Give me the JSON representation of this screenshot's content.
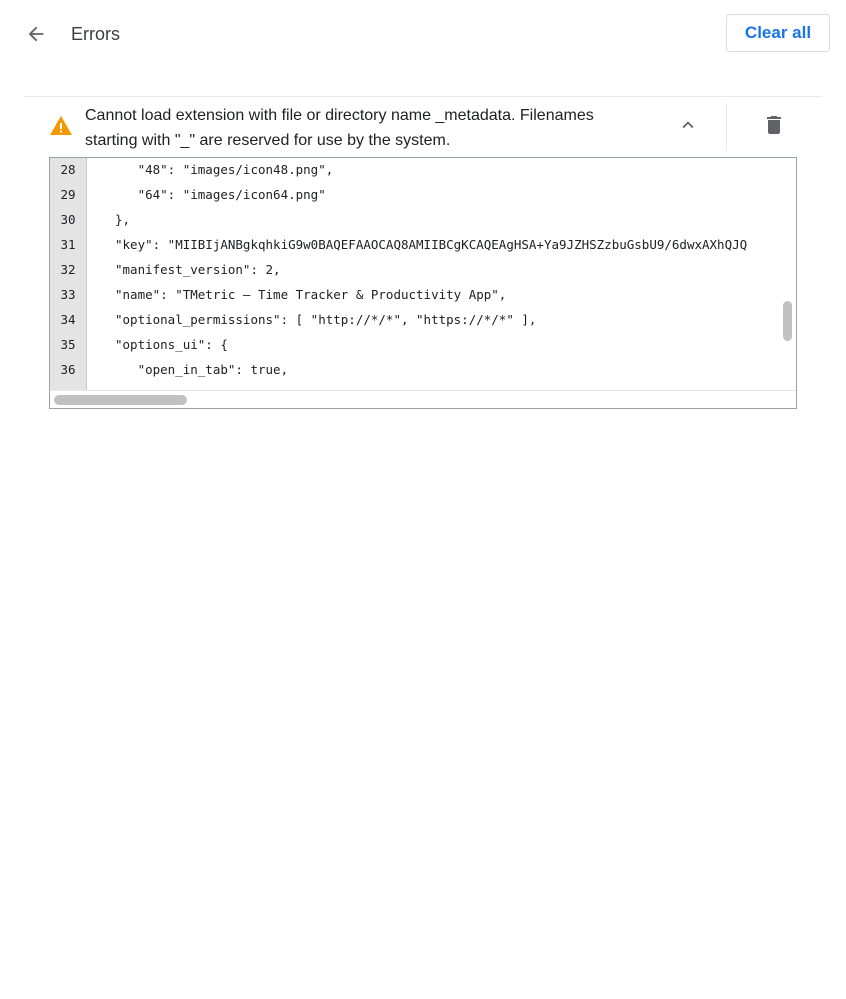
{
  "header": {
    "title": "Errors",
    "back_icon": "arrow-left-icon",
    "clear_all_label": "Clear all"
  },
  "error": {
    "icon": "warning-triangle-icon",
    "message": "Cannot load extension with file or directory name _metadata. Filenames starting with \"_\" are reserved for use by the system.",
    "expand_icon": "chevron-up-icon",
    "delete_icon": "trash-icon"
  },
  "code": {
    "lines": [
      {
        "num": "28",
        "text": "    \"48\": \"images/icon48.png\","
      },
      {
        "num": "29",
        "text": "    \"64\": \"images/icon64.png\""
      },
      {
        "num": "30",
        "text": " },"
      },
      {
        "num": "31",
        "text": " \"key\": \"MIIBIjANBgkqhkiG9w0BAQEFAAOCAQ8AMIIBCgKCAQEAgHSA+Ya9JZHSZzbuGsbU9/6dwxAXhQJQ"
      },
      {
        "num": "32",
        "text": " \"manifest_version\": 2,"
      },
      {
        "num": "33",
        "text": " \"name\": \"TMetric — Time Tracker & Productivity App\","
      },
      {
        "num": "34",
        "text": " \"optional_permissions\": [ \"http://*/*\", \"https://*/*\" ],"
      },
      {
        "num": "35",
        "text": " \"options_ui\": {"
      },
      {
        "num": "36",
        "text": "    \"open_in_tab\": true,"
      }
    ]
  },
  "colors": {
    "accent": "#1a73e8",
    "warning": "#f29900",
    "icon_gray": "#5f6368"
  }
}
